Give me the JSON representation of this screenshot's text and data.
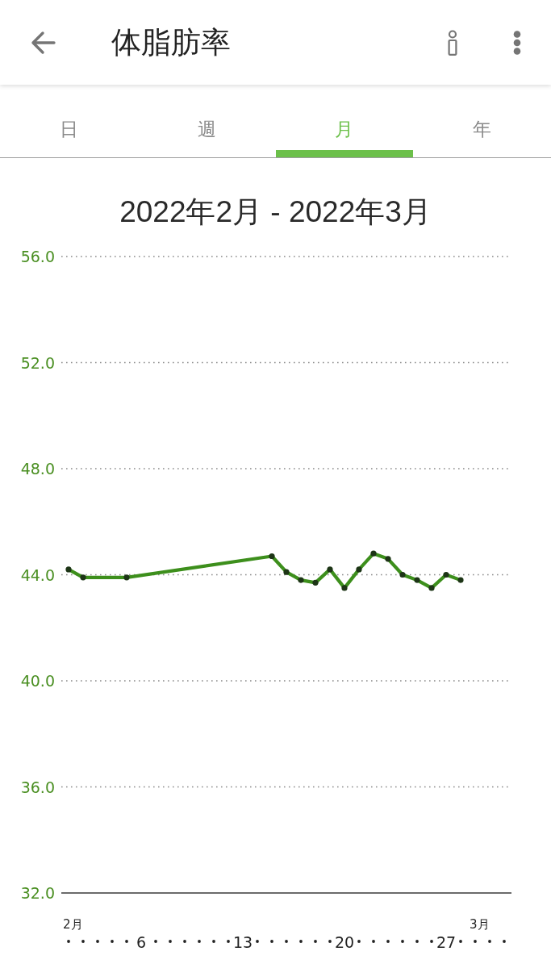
{
  "app_bar": {
    "title": "体脂肪率"
  },
  "tabs": [
    {
      "label": "日",
      "selected": false
    },
    {
      "label": "週",
      "selected": false
    },
    {
      "label": "月",
      "selected": true
    },
    {
      "label": "年",
      "selected": false
    }
  ],
  "chart": {
    "chart_data": {
      "type": "line",
      "title": "2022年2月 - 2022年3月",
      "x": [
        1,
        2,
        5,
        15,
        16,
        17,
        18,
        19,
        20,
        21,
        22,
        23,
        24,
        25,
        26,
        27,
        28
      ],
      "values": [
        44.2,
        43.9,
        43.9,
        44.7,
        44.1,
        43.8,
        43.7,
        44.2,
        43.5,
        44.2,
        44.8,
        44.6,
        44.0,
        43.8,
        43.5,
        44.0,
        43.8
      ],
      "xlim": [
        0.5,
        31.5
      ],
      "ylim": [
        32,
        56
      ],
      "xticks": [
        {
          "value": 6,
          "label": "6"
        },
        {
          "value": 13,
          "label": "13"
        },
        {
          "value": 20,
          "label": "20"
        },
        {
          "value": 27,
          "label": "27"
        }
      ],
      "yticks": [
        {
          "value": 56,
          "label": "56.0"
        },
        {
          "value": 52,
          "label": "52.0"
        },
        {
          "value": 48,
          "label": "48.0"
        },
        {
          "value": 44,
          "label": "44.0"
        },
        {
          "value": 40,
          "label": "40.0"
        },
        {
          "value": 36,
          "label": "36.0"
        },
        {
          "value": 32,
          "label": "32.0"
        }
      ],
      "grid": true,
      "marker": "circle"
    },
    "month_labels": [
      "2月",
      "3月"
    ]
  }
}
